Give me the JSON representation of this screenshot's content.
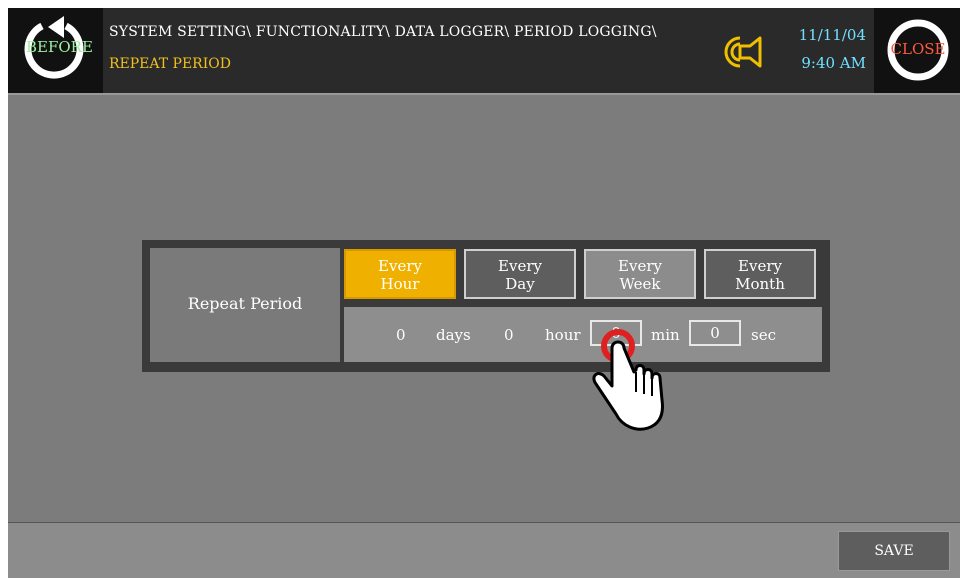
{
  "header": {
    "before_label": "BEFORE",
    "path": "SYSTEM SETTING\\ FUNCTIONALITY\\ DATA LOGGER\\ PERIOD LOGGING\\",
    "subtitle": "REPEAT PERIOD",
    "date": "11/11/04",
    "time": "9:40 AM",
    "close_label": "CLOSE"
  },
  "panel": {
    "label": "Repeat Period",
    "options": [
      {
        "line1": "Every",
        "line2": "Hour",
        "selected": true
      },
      {
        "line1": "Every",
        "line2": "Day",
        "selected": false
      },
      {
        "line1": "Every",
        "line2": "Week",
        "selected": false
      },
      {
        "line1": "Every",
        "line2": "Month",
        "selected": false
      }
    ],
    "days_value": "0",
    "days_unit": "days",
    "hour_value": "0",
    "hour_unit": "hour",
    "min_value": "0",
    "min_unit": "min",
    "sec_value": "0",
    "sec_unit": "sec"
  },
  "footer": {
    "save_label": "SAVE"
  },
  "colors": {
    "background": "#7c7c7c",
    "header": "#2a2a2a",
    "selected": "#f0b000",
    "path_text": "#ffffff",
    "subtitle_text": "#f0c020",
    "datetime_text": "#6fe0ff",
    "before_text": "#9ef0a0",
    "close_text": "#ff5a40",
    "pointer_ring": "#e02020"
  },
  "icons": {
    "before": "refresh-arrow-icon",
    "speaker": "speaker-sound-icon",
    "close": "ring-icon",
    "pointer": "hand-pointer-icon"
  }
}
